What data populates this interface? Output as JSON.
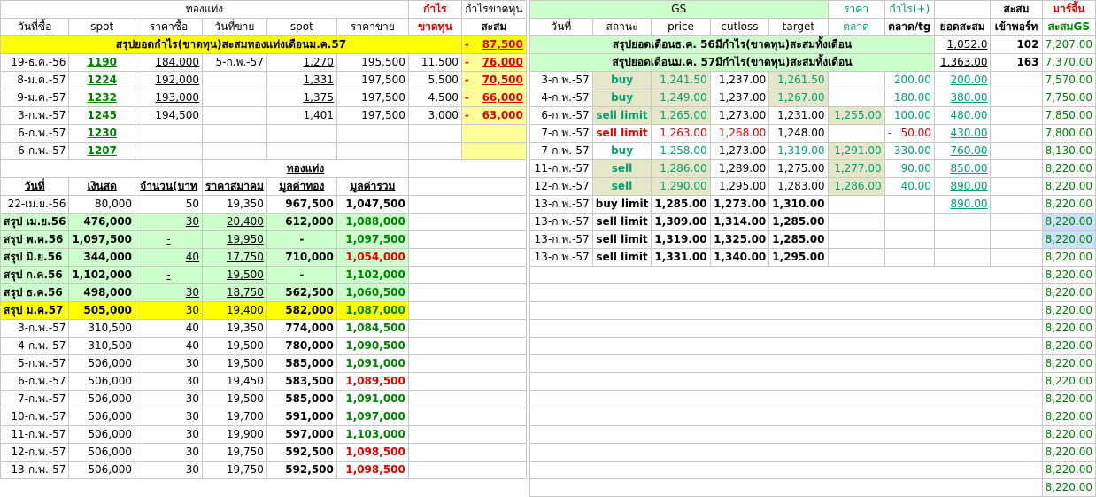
{
  "left": {
    "header1": {
      "thong": "ทองแท่ง",
      "kamrai": "กำไร",
      "kamrai_khadthun": "กำไรขาดทุน"
    },
    "header2": [
      "วันที่ซื้อ",
      "spot",
      "ราคาซื้อ",
      "วันที่ขาย",
      "spot",
      "ราคาขาย",
      "ขาดทุน",
      "สะสม"
    ],
    "summary_row": {
      "label": "สรุปยอดกำไร(ขาดทุน)สะสมทองแท่งเดือนม.ค.57",
      "dash": "-",
      "value": "87,500"
    },
    "trades": [
      {
        "date": "19-ธ.ค.-56",
        "spot": "1190",
        "buy": "184,000",
        "sell_date": "5-ก.พ.-57",
        "sell_spot": "1,270",
        "sell": "195,500",
        "profit": "11,500",
        "dash": "-",
        "cum": "76,000"
      },
      {
        "date": "8-ม.ค.-57",
        "spot": "1224",
        "buy": "192,000",
        "sell_date": "",
        "sell_spot": "1,331",
        "sell": "197,500",
        "profit": "5,500",
        "dash": "-",
        "cum": "70,500"
      },
      {
        "date": "9-ม.ค.-57",
        "spot": "1232",
        "buy": "193,000",
        "sell_date": "",
        "sell_spot": "1,375",
        "sell": "197,500",
        "profit": "4,500",
        "dash": "-",
        "cum": "66,000"
      },
      {
        "date": "3-ก.พ.-57",
        "spot": "1245",
        "buy": "194,500",
        "sell_date": "",
        "sell_spot": "1,401",
        "sell": "197,500",
        "profit": "3,000",
        "dash": "-",
        "cum": "63,000"
      },
      {
        "date": "6-ก.พ.-57",
        "spot": "1230",
        "buy": "",
        "sell_date": "",
        "sell_spot": "",
        "sell": "",
        "profit": "",
        "dash": "",
        "cum": ""
      },
      {
        "date": "6-ก.พ.-57",
        "spot": "1207",
        "buy": "",
        "sell_date": "",
        "sell_spot": "",
        "sell": "",
        "profit": "",
        "dash": "",
        "cum": ""
      }
    ],
    "section_title": "ทองแท่ง",
    "header3": [
      "วันที่",
      "เงินสด",
      "จำนวน(บาท",
      "ราคาสมาคม",
      "มูลค่าทอง",
      "มูลค่ารวม"
    ],
    "holdings": [
      {
        "date": "22-เม.ย.-56",
        "cash": "80,000",
        "qty": "50",
        "price": "19,350",
        "gold": "967,500",
        "total": "1,047,500",
        "style": "plain",
        "total_color": "black"
      },
      {
        "date": "สรุป เม.ย.56",
        "cash": "476,000",
        "qty": "30",
        "price": "20,400",
        "gold": "612,000",
        "total": "1,088,000",
        "style": "green",
        "total_color": "green"
      },
      {
        "date": "สรุป พ.ค.56",
        "cash": "1,097,500",
        "qty": "-",
        "price": "19,950",
        "gold": "-",
        "total": "1,097,500",
        "style": "green",
        "total_color": "green"
      },
      {
        "date": "สรุป มิ.ย.56",
        "cash": "344,000",
        "qty": "40",
        "price": "17,750",
        "gold": "710,000",
        "total": "1,054,000",
        "style": "green",
        "total_color": "red"
      },
      {
        "date": "สรุป ก.ค.56",
        "cash": "1,102,000",
        "qty": "-",
        "price": "19,500",
        "gold": "-",
        "total": "1,102,000",
        "style": "green",
        "total_color": "green"
      },
      {
        "date": "สรุป ธ.ค.56",
        "cash": "498,000",
        "qty": "30",
        "price": "18,750",
        "gold": "562,500",
        "total": "1,060,500",
        "style": "green",
        "total_color": "green"
      },
      {
        "date": "สรุป ม.ค.57",
        "cash": "505,000",
        "qty": "30",
        "price": "19,400",
        "gold": "582,000",
        "total": "1,087,000",
        "style": "yellow",
        "total_color": "green"
      },
      {
        "date": "3-ก.พ.-57",
        "cash": "310,500",
        "qty": "40",
        "price": "19,350",
        "gold": "774,000",
        "total": "1,084,500",
        "style": "plain",
        "total_color": "green"
      },
      {
        "date": "4-ก.พ.-57",
        "cash": "310,500",
        "qty": "40",
        "price": "19,500",
        "gold": "780,000",
        "total": "1,090,500",
        "style": "plain",
        "total_color": "green"
      },
      {
        "date": "5-ก.พ.-57",
        "cash": "506,000",
        "qty": "30",
        "price": "19,500",
        "gold": "585,000",
        "total": "1,091,000",
        "style": "plain",
        "total_color": "green"
      },
      {
        "date": "6-ก.พ.-57",
        "cash": "506,000",
        "qty": "30",
        "price": "19,450",
        "gold": "583,500",
        "total": "1,089,500",
        "style": "plain",
        "total_color": "red"
      },
      {
        "date": "7-ก.พ.-57",
        "cash": "506,000",
        "qty": "30",
        "price": "19,500",
        "gold": "585,000",
        "total": "1,091,000",
        "style": "plain",
        "total_color": "green"
      },
      {
        "date": "10-ก.พ.-57",
        "cash": "506,000",
        "qty": "30",
        "price": "19,700",
        "gold": "591,000",
        "total": "1,097,000",
        "style": "plain",
        "total_color": "green"
      },
      {
        "date": "11-ก.พ.-57",
        "cash": "506,000",
        "qty": "30",
        "price": "19,900",
        "gold": "597,000",
        "total": "1,103,000",
        "style": "plain",
        "total_color": "green"
      },
      {
        "date": "12-ก.พ.-57",
        "cash": "506,000",
        "qty": "30",
        "price": "19,750",
        "gold": "592,500",
        "total": "1,098,500",
        "style": "plain",
        "total_color": "red"
      },
      {
        "date": "13-ก.พ.-57",
        "cash": "506,000",
        "qty": "30",
        "price": "19,750",
        "gold": "592,500",
        "total": "1,098,500",
        "style": "plain",
        "total_color": "red"
      }
    ]
  },
  "right": {
    "header1": {
      "gs": "GS",
      "rakha": "ราคา",
      "kamrai": "กำไร(+)",
      "sasom": "สะสม",
      "margin": "มาร์จิ้น"
    },
    "header2": [
      "วันที่",
      "สถานะ",
      "price",
      "cutloss",
      "target",
      "ตลาด",
      "ตลาด/tg",
      "ยอดสะสม",
      "เข้าพอร์ท",
      "สะสมGS"
    ],
    "summaries": [
      {
        "label": "สรุปยอดเดือนธ.ค. 56มีกำไร(ขาดทุน)สะสมทั้งเดือน",
        "cum": "1,052.0",
        "port": "102",
        "gs": "7,207.00"
      },
      {
        "label": "สรุปยอดเดือนม.ค. 57มีกำไร(ขาดทุน)สะสมทั้งเดือน",
        "cum": "1,363.00",
        "port": "163",
        "gs": "7,370.00"
      }
    ],
    "trades": [
      {
        "date": "3-ก.พ.-57",
        "status": "buy",
        "price": "1,241.50",
        "cut": "1,237.00",
        "target": "1,261.50",
        "market": "",
        "dash": "",
        "mtg": "200.00",
        "cum": "200.00",
        "gs": "7,570.00",
        "kind": "buy"
      },
      {
        "date": "4-ก.พ.-57",
        "status": "buy",
        "price": "1,249.00",
        "cut": "1,237.00",
        "target": "1,267.00",
        "market": "",
        "dash": "",
        "mtg": "180.00",
        "cum": "380.00",
        "gs": "7,750.00",
        "kind": "buy"
      },
      {
        "date": "6-ก.พ.-57",
        "status": "sell limit",
        "price": "1,265.00",
        "cut": "1,273.00",
        "target": "1,231.00",
        "market": "1,255.00",
        "dash": "",
        "mtg": "100.00",
        "cum": "480.00",
        "gs": "7,850.00",
        "kind": "selllimit"
      },
      {
        "date": "7-ก.พ.-57",
        "status": "sell limit",
        "price": "1,263.00",
        "cut": "1,268.00",
        "target": "1,248.00",
        "market": "",
        "dash": "-",
        "mtg": "50.00",
        "cum": "430.00",
        "gs": "7,800.00",
        "kind": "red"
      },
      {
        "date": "7-ก.พ.-57",
        "status": "buy",
        "price": "1,258.00",
        "cut": "1,273.00",
        "target": "1,319.00",
        "market": "1,291.00",
        "dash": "",
        "mtg": "330.00",
        "cum": "760.00",
        "gs": "8,130.00",
        "kind": "buy2"
      },
      {
        "date": "11-ก.พ.-57",
        "status": "sell",
        "price": "1,286.00",
        "cut": "1,289.00",
        "target": "1,275.00",
        "market": "1,277.00",
        "dash": "",
        "mtg": "90.00",
        "cum": "850.00",
        "gs": "8,220.00",
        "kind": "sell"
      },
      {
        "date": "12-ก.พ.-57",
        "status": "sell",
        "price": "1,290.00",
        "cut": "1,295.00",
        "target": "1,283.00",
        "market": "1,286.00",
        "dash": "",
        "mtg": "40.00",
        "cum": "890.00",
        "gs": "8,220.00",
        "kind": "sell"
      },
      {
        "date": "13-ก.พ.-57",
        "status": "buy limit",
        "price": "1,285.00",
        "cut": "1,273.00",
        "target": "1,310.00",
        "market": "",
        "dash": "",
        "mtg": "",
        "cum": "890.00",
        "gs": "8,220.00",
        "kind": "pending"
      },
      {
        "date": "13-ก.พ.-57",
        "status": "sell limit",
        "price": "1,309.00",
        "cut": "1,314.00",
        "target": "1,285.00",
        "market": "",
        "dash": "",
        "mtg": "",
        "cum": "",
        "gs": "8,220.00",
        "kind": "pending"
      },
      {
        "date": "13-ก.พ.-57",
        "status": "sell limit",
        "price": "1,319.00",
        "cut": "1,325.00",
        "target": "1,285.00",
        "market": "",
        "dash": "",
        "mtg": "",
        "cum": "",
        "gs": "8,220.00",
        "kind": "pending"
      },
      {
        "date": "13-ก.พ.-57",
        "status": "sell limit",
        "price": "1,331.00",
        "cut": "1,340.00",
        "target": "1,295.00",
        "market": "",
        "dash": "",
        "mtg": "",
        "cum": "",
        "gs": "8,220.00",
        "kind": "pending"
      }
    ],
    "trailing_gs": [
      "8,220.00",
      "8,220.00",
      "8,220.00",
      "8,220.00",
      "8,220.00",
      "8,220.00",
      "8,220.00",
      "8,220.00",
      "8,220.00",
      "8,220.00",
      "8,220.00",
      "8,220.00",
      "8,220.00"
    ]
  }
}
